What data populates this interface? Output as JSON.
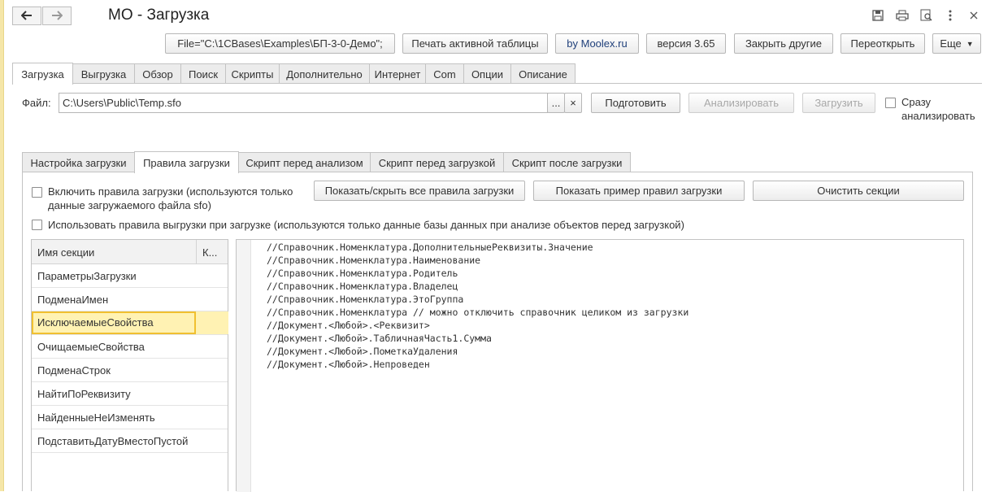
{
  "window": {
    "title": "МО - Загрузка"
  },
  "toolbar": {
    "file_button": "File=\"C:\\1CBases\\Examples\\БП-3-0-Демо\";",
    "print_button": "Печать активной таблицы",
    "by_button": "by Moolex.ru",
    "version_button": "версия 3.65",
    "close_others_button": "Закрыть другие",
    "reopen_button": "Переоткрыть",
    "more_button": "Еще"
  },
  "main_tabs": [
    "Загрузка",
    "Выгрузка",
    "Обзор",
    "Поиск",
    "Скрипты",
    "Дополнительно",
    "Интернет",
    "Com",
    "Опции",
    "Описание"
  ],
  "file_row": {
    "label": "Файл:",
    "value": "C:\\Users\\Public\\Temp.sfo",
    "browse": "...",
    "clear": "×",
    "prepare_button": "Подготовить",
    "analyze_button": "Анализировать",
    "load_button": "Загрузить",
    "analyze_now_line1": "Сразу",
    "analyze_now_line2": "анализировать"
  },
  "sub_tabs": [
    "Настройка загрузки",
    "Правила загрузки",
    "Скрипт перед анализом",
    "Скрипт перед загрузкой",
    "Скрипт после загрузки"
  ],
  "rules": {
    "include_rules_line1": "Включить правила загрузки (используются только",
    "include_rules_line2": "данные загружаемого файла sfo)",
    "show_hide_button": "Показать/скрыть все правила загрузки",
    "show_example_button": "Показать пример правил загрузки",
    "clear_sections_button": "Очистить секции",
    "use_export_rules": "Использовать правила выгрузки при загрузке (используются только данные базы данных при анализе объектов перед загрузкой)"
  },
  "sections": {
    "col_name": "Имя секции",
    "col_k": "К...",
    "rows": [
      "ПараметрыЗагрузки",
      "ПодменаИмен",
      "ИсключаемыеСвойства",
      "ОчищаемыеСвойства",
      "ПодменаСтрок",
      "НайтиПоРеквизиту",
      "НайденныеНеИзменять",
      "ПодставитьДатуВместоПустой"
    ],
    "selected_index": 2
  },
  "code_lines": [
    "//Справочник.Номенклатура.ДополнительныеРеквизиты.Значение",
    "//Справочник.Номенклатура.Наименование",
    "//Справочник.Номенклатура.Родитель",
    "//Справочник.Номенклатура.Владелец",
    "//Справочник.Номенклатура.ЭтоГруппа",
    "//Справочник.Номенклатура // можно отключить справочник целиком из загрузки",
    "//Документ.<Любой>.<Реквизит>",
    "//Документ.<Любой>.ТабличнаяЧасть1.Сумма",
    "//Документ.<Любой>.ПометкаУдаления",
    "//Документ.<Любой>.Непроведен"
  ],
  "icons": {
    "back": "arrow-left",
    "forward": "arrow-right",
    "save": "floppy",
    "print": "printer",
    "preview": "magnifier-page",
    "menu": "vertical-dots",
    "close": "cross"
  },
  "colors": {
    "selection_fill": "#fff2b3",
    "selection_border": "#f0c030",
    "left_strip": "#f5e6a8"
  }
}
